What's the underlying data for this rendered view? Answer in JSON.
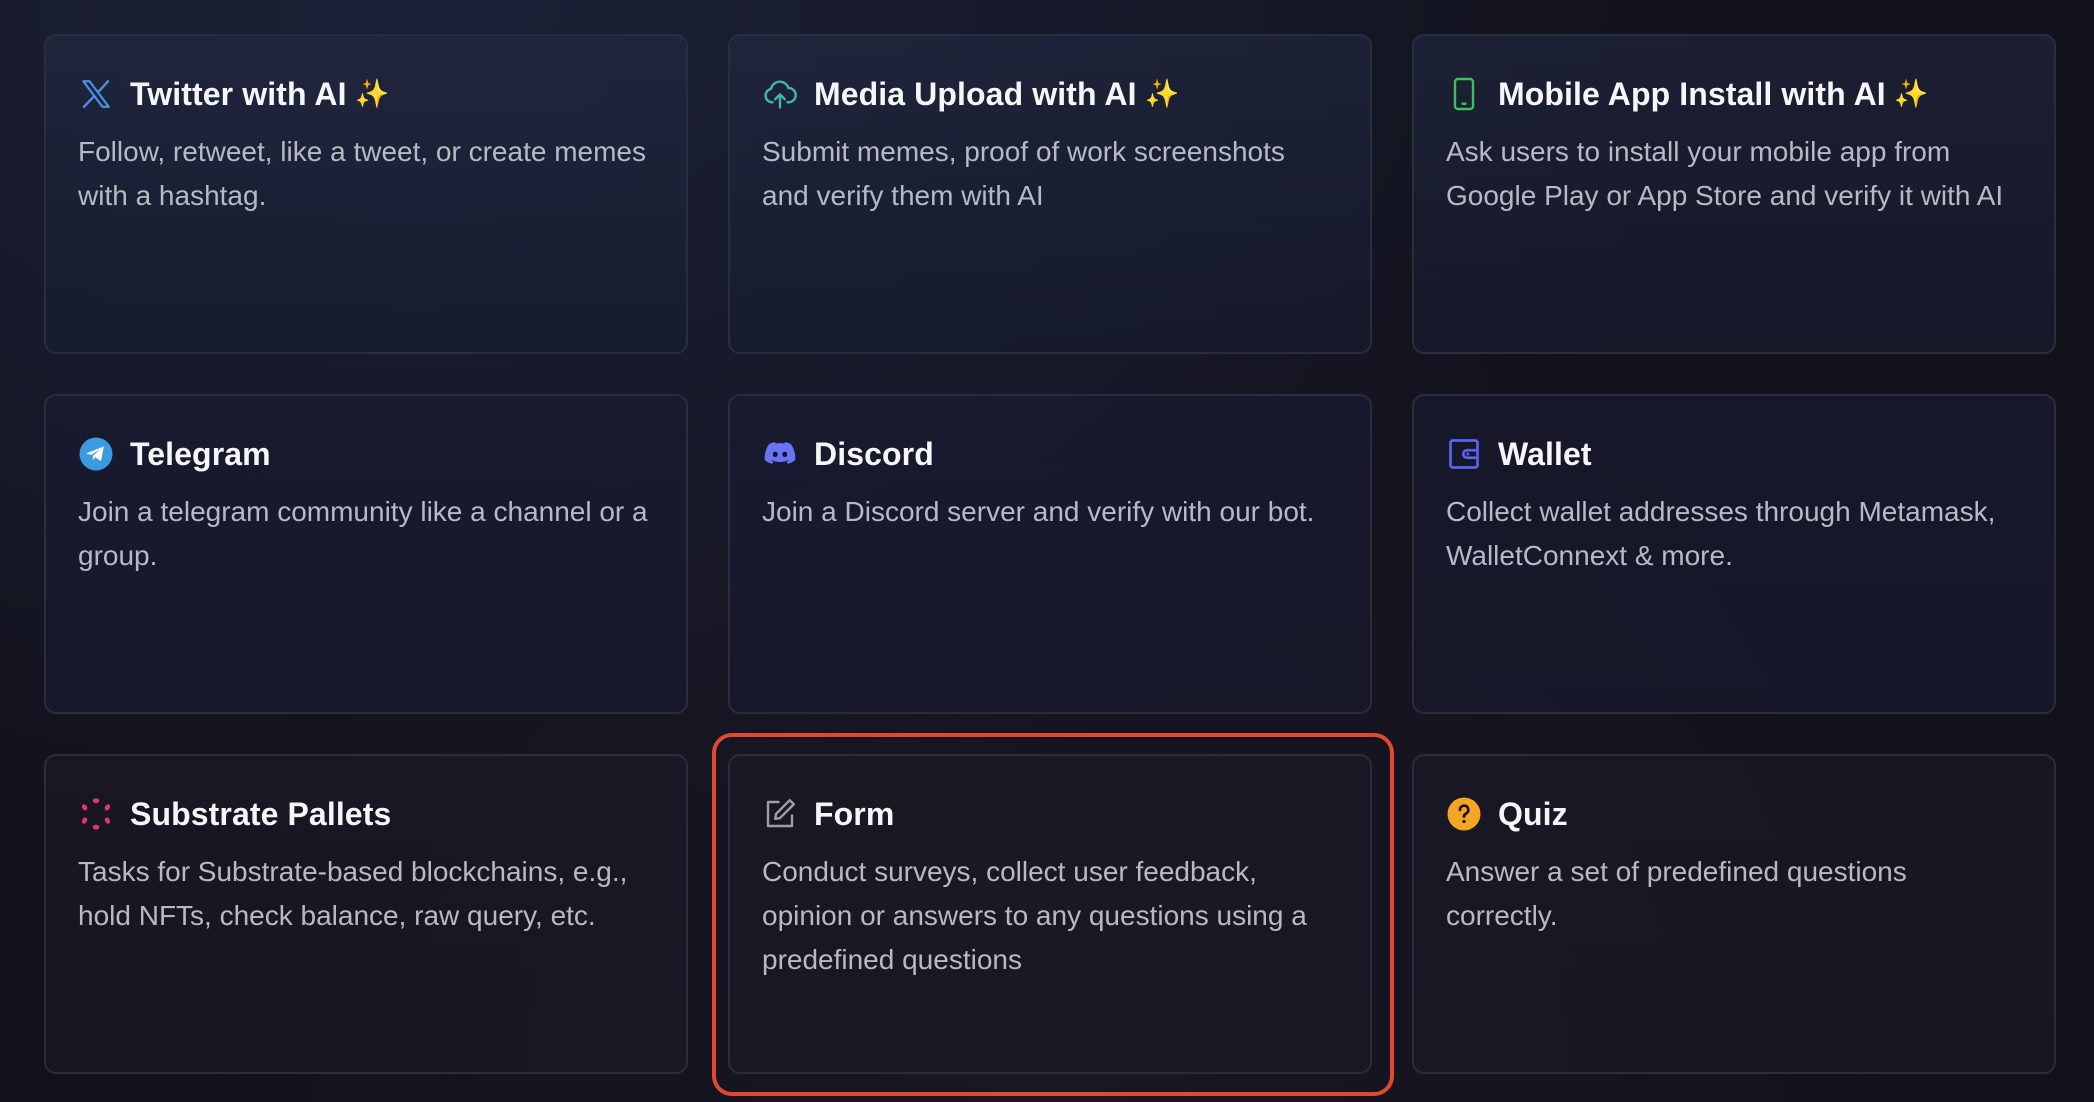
{
  "cards": [
    {
      "title": "Twitter with AI",
      "sparkle": "✨",
      "description": "Follow, retweet, like a tweet, or create memes with a hashtag.",
      "icon": "x-logo-icon",
      "accent": "#4a90e2"
    },
    {
      "title": "Media Upload with AI",
      "sparkle": "✨",
      "description": "Submit memes, proof of work screenshots and verify them with AI",
      "icon": "cloud-upload-icon",
      "accent": "#3fb8a6"
    },
    {
      "title": "Mobile App Install with AI",
      "sparkle": "✨",
      "description": "Ask users to install your mobile app from Google Play or App Store and verify it with AI",
      "icon": "mobile-phone-icon",
      "accent": "#3fbf5f"
    },
    {
      "title": "Telegram",
      "description": "Join a telegram community like a channel or a group.",
      "icon": "telegram-icon",
      "accent": "#3b9ae1"
    },
    {
      "title": "Discord",
      "description": "Join a Discord server and verify with our bot.",
      "icon": "discord-icon",
      "accent": "#6a73f2"
    },
    {
      "title": "Wallet",
      "description": "Collect wallet addresses through Metamask, WalletConnext & more.",
      "icon": "wallet-icon",
      "accent": "#5b62f0"
    },
    {
      "title": "Substrate Pallets",
      "description": "Tasks for Substrate-based blockchains, e.g., hold NFTs, check balance, raw query, etc.",
      "icon": "polkadot-icon",
      "accent": "#e6317a"
    },
    {
      "title": "Form",
      "description": "Conduct surveys, collect user feedback, opinion or answers to any questions using a predefined questions",
      "icon": "edit-form-icon",
      "accent": "#9aa0aa"
    },
    {
      "title": "Quiz",
      "description": "Answer a set of predefined questions correctly.",
      "icon": "question-circle-icon",
      "accent": "#f5a524"
    }
  ],
  "highlight_color": "#e04a2f"
}
